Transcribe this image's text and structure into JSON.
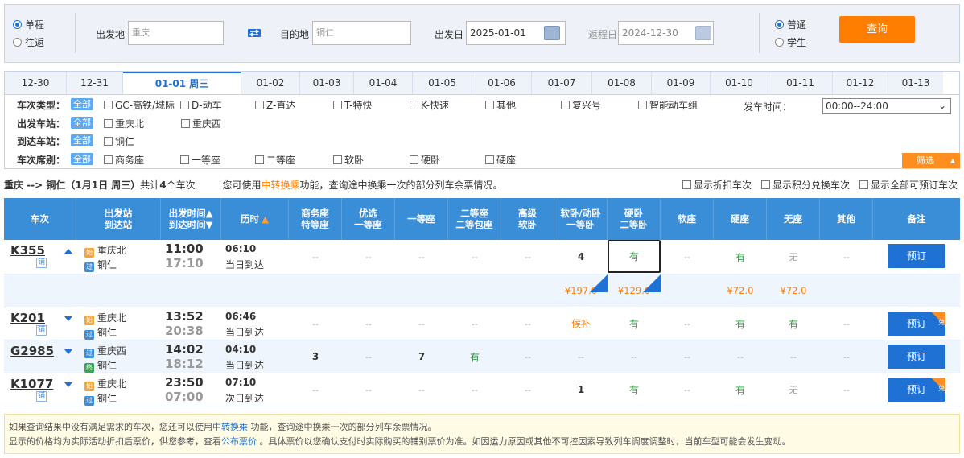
{
  "search": {
    "trip_oneway": "单程",
    "trip_round": "往返",
    "from_label": "出发地",
    "from_value": "重庆",
    "to_label": "目的地",
    "to_value": "铜仁",
    "depart_label": "出发日",
    "depart_value": "2025-01-01",
    "return_label": "返程日",
    "return_value": "2024-12-30",
    "type_normal": "普通",
    "type_student": "学生",
    "query_label": "查询"
  },
  "date_tabs": [
    "12-30",
    "12-31",
    "01-01 周三",
    "01-02",
    "01-03",
    "01-04",
    "01-05",
    "01-06",
    "01-07",
    "01-08",
    "01-09",
    "01-10",
    "01-11",
    "01-12",
    "01-13"
  ],
  "selected_tab": 2,
  "filters": {
    "type_label": "车次类型：",
    "all": "全部",
    "types": [
      "GC-高铁/城际",
      "D-动车",
      "Z-直达",
      "T-特快",
      "K-快速",
      "其他",
      "复兴号",
      "智能动车组"
    ],
    "depart_time_label": "发车时间：",
    "depart_time_value": "00:00--24:00",
    "from_station_label": "出发车站：",
    "from_stations": [
      "重庆北",
      "重庆西"
    ],
    "to_station_label": "到达车站：",
    "to_stations": [
      "铜仁"
    ],
    "seat_label": "车次席别：",
    "seats": [
      "商务座",
      "一等座",
      "二等座",
      "软卧",
      "硬卧",
      "硬座"
    ],
    "filter_button": "筛选"
  },
  "info": {
    "route": "重庆 --> 铜仁（1月1日 周三）",
    "count_pre": "共计",
    "count": "4",
    "count_post": "个车次",
    "hint_pre": "您可使用",
    "hint_link": "中转换乘",
    "hint_post": "功能，查询途中换乘一次的部分列车余票情况。",
    "opt1": "显示折扣车次",
    "opt2": "显示积分兑换车次",
    "opt3": "显示全部可预订车次"
  },
  "header": {
    "train": "车次",
    "station1": "出发站",
    "station2": "到达站",
    "time1": "出发时间▲",
    "time2": "到达时间▼",
    "duration": "历时",
    "business1": "商务座",
    "business2": "特等座",
    "premium1": "优选",
    "premium2": "一等座",
    "first": "一等座",
    "second1": "二等座",
    "second2": "二等包座",
    "deluxe1": "高级",
    "deluxe2": "软卧",
    "soft1": "软卧/动卧",
    "soft2": "一等卧",
    "hard1": "硬卧",
    "hard2": "二等卧",
    "softseat": "软座",
    "hardseat": "硬座",
    "noseat": "无座",
    "other": "其他",
    "remark": "备注"
  },
  "trains": [
    {
      "no": "K355",
      "fu": "铺",
      "from": "重庆北",
      "from_badge": "始",
      "to": "铜仁",
      "to_badge": "过",
      "dep": "11:00",
      "arr": "17:10",
      "dur": "06:10",
      "day": "当日到达",
      "seats": [
        "--",
        "--",
        "--",
        "--",
        "--",
        "4",
        "有",
        "--",
        "有",
        "无",
        "--"
      ],
      "book": "预订"
    },
    {
      "no": "K201",
      "fu": "铺",
      "from": "重庆北",
      "from_badge": "始",
      "to": "铜仁",
      "to_badge": "过",
      "dep": "13:52",
      "arr": "20:38",
      "dur": "06:46",
      "day": "当日到达",
      "seats": [
        "--",
        "--",
        "--",
        "--",
        "--",
        "候补",
        "有",
        "--",
        "有",
        "有",
        "--"
      ],
      "book": "预订"
    },
    {
      "no": "G2985",
      "fu": "",
      "from": "重庆西",
      "from_badge": "过",
      "to": "铜仁",
      "to_badge": "终",
      "dep": "14:02",
      "arr": "18:12",
      "dur": "04:10",
      "day": "当日到达",
      "seats": [
        "3",
        "--",
        "7",
        "有",
        "--",
        "--",
        "--",
        "--",
        "--",
        "--",
        "--"
      ],
      "book": "预订"
    },
    {
      "no": "K1077",
      "fu": "铺",
      "from": "重庆北",
      "from_badge": "始",
      "to": "铜仁",
      "to_badge": "过",
      "dep": "23:50",
      "arr": "07:00",
      "dur": "07:10",
      "day": "次日到达",
      "seats": [
        "--",
        "--",
        "--",
        "--",
        "--",
        "1",
        "有",
        "--",
        "有",
        "无",
        "--"
      ],
      "book": "预订"
    }
  ],
  "prices": {
    "soft": "¥197.0",
    "hard": "¥129.0",
    "hardseat": "¥72.0",
    "noseat": "¥72.0"
  },
  "corner_badge": "兑",
  "footer": {
    "line1_pre": "如果查询结果中没有满足需求的车次，您还可以使用",
    "line1_link": "中转换乘",
    "line1_post": " 功能，查询途中换乘一次的部分列车余票情况。",
    "line2_pre": "显示的价格均为实际活动折扣后票价，供您参考，查看",
    "line2_link": "公布票价",
    "line2_post": " 。具体票价以您确认支付时实际购买的铺别票价为准。如因运力原因或其他不可控因素导致列车调度调整时，当前车型可能会发生变动。"
  },
  "colors": {
    "accent": "#1f72d4",
    "header": "#3a8ed8",
    "orange": "#ff7e00",
    "green": "#26a03a"
  }
}
